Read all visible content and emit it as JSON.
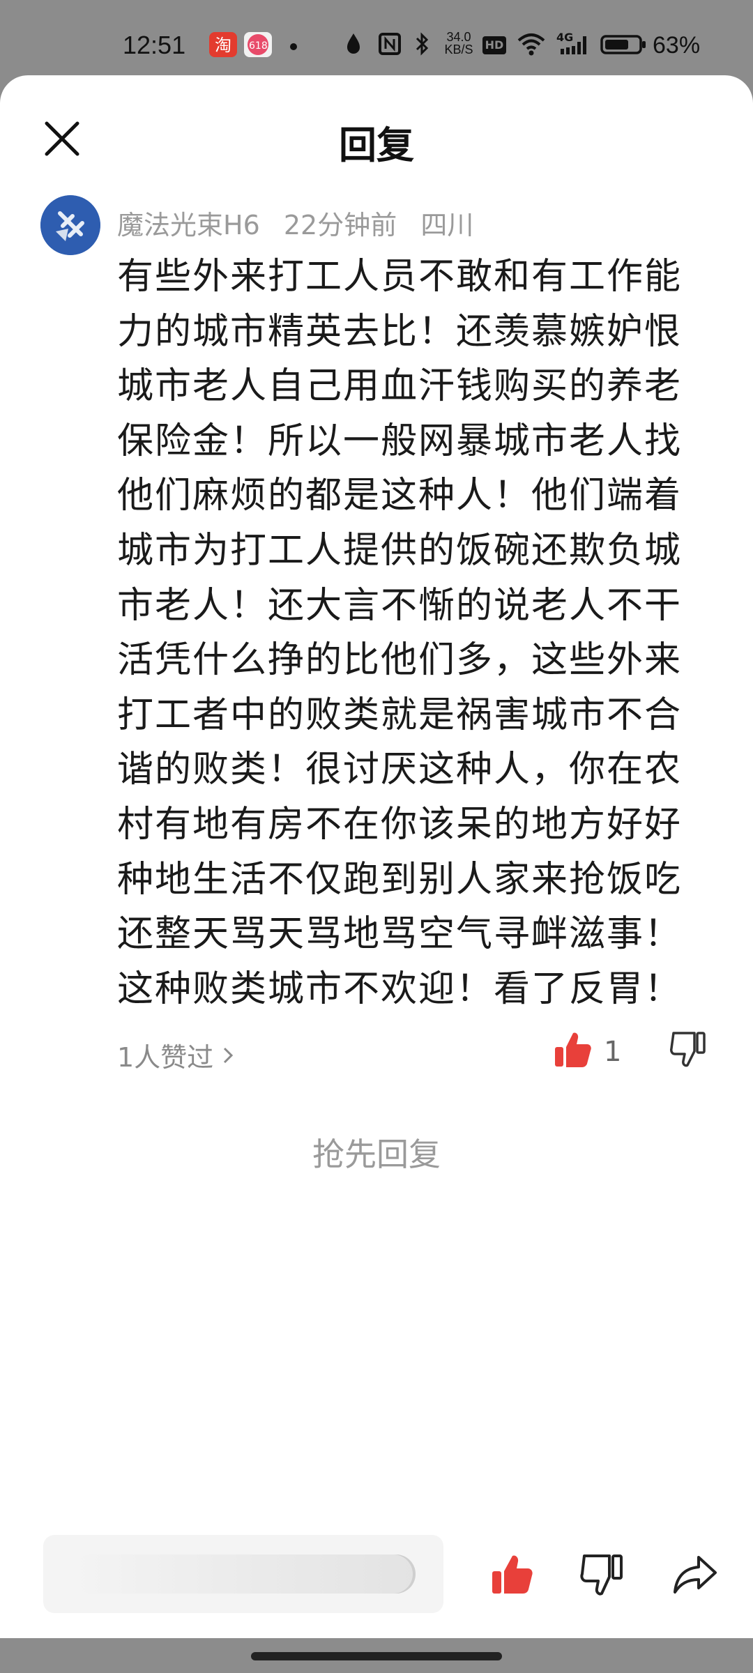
{
  "status_bar": {
    "time": "12:51",
    "network_speed": "34.0\nKB/S",
    "hd": "HD",
    "network_type": "4G",
    "battery": "63%",
    "icons": [
      "taobao-app-icon",
      "618-app-icon",
      "dot-icon",
      "drop-icon",
      "nfc-icon",
      "bluetooth-icon",
      "speed-icon",
      "hd-icon",
      "wifi-icon",
      "signal-icon",
      "battery-icon"
    ]
  },
  "header": {
    "title": "回复",
    "close_icon": "close-icon"
  },
  "comment": {
    "author": "魔法光束H6",
    "time_ago": "22分钟前",
    "location": "四川",
    "lines": [
      "有些外来打工人员不敢和有工作能",
      "力的城市精英去比！还羡慕嫉妒恨",
      "城市老人自己用血汗钱购买的养老",
      "保险金！所以一般网暴城市老人找",
      "他们麻烦的都是这种人！他们端着",
      "城市为打工人提供的饭碗还欺负城",
      "市老人！还大言不惭的说老人不干",
      "活凭什么挣的比他们多，这些外来",
      "打工者中的败类就是祸害城市不合",
      "谐的败类！很讨厌这种人，你在农",
      "村有地有房不在你该呆的地方好好",
      "种地生活不仅跑到别人家来抢饭吃",
      "还整天骂天骂地骂空气寻衅滋事！",
      "这种败类城市不欢迎！看了反胃！"
    ],
    "likes_summary": "1人赞过",
    "like_count": "1",
    "like_color": "#e8403a"
  },
  "reply_first": "抢先回复",
  "bottom_bar": {
    "input_placeholder": "",
    "icons": [
      "thumbs-up-icon",
      "thumbs-down-icon",
      "share-icon"
    ]
  }
}
